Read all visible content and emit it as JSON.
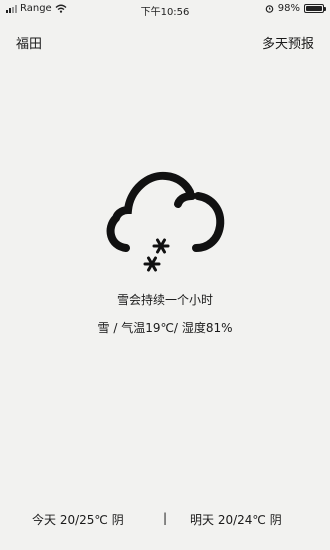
{
  "status_bar": {
    "carrier": "Range",
    "time": "下午10:56",
    "battery_percent": "98%",
    "battery_level": 0.98
  },
  "header": {
    "city": "福田",
    "forecast_link": "多天预报"
  },
  "weather": {
    "icon": "snow-cloud-icon",
    "condition_text": "雪会持续一个小时",
    "type": "雪",
    "sep": " / ",
    "temperature": "气温19℃/",
    "humidity": "湿度81%"
  },
  "forecast": {
    "today": "今天 20/25℃ 阴",
    "divider": "|",
    "tomorrow": "明天 20/24℃ 阴"
  }
}
